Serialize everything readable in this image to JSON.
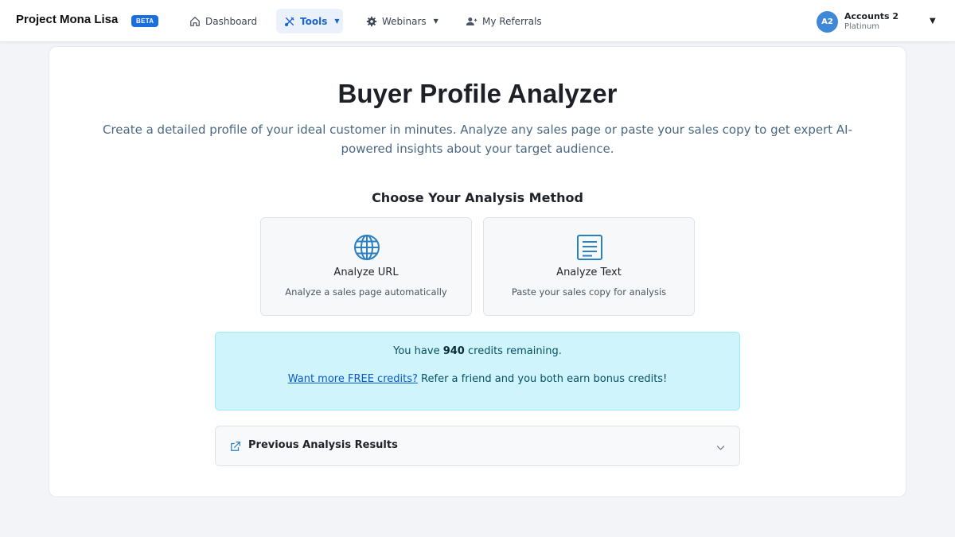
{
  "nav": {
    "brand": "Project Mona Lisa",
    "badge": "BETA",
    "items": [
      {
        "label": "Dashboard",
        "icon": "home-icon"
      },
      {
        "label": "Tools",
        "icon": "tools-icon",
        "active": true,
        "dropdown": true
      },
      {
        "label": "Webinars",
        "icon": "gear-icon",
        "dropdown": true
      },
      {
        "label": "My Referrals",
        "icon": "user-plus-icon"
      }
    ],
    "account": {
      "initials": "A2",
      "name": "Accounts 2",
      "tier": "Platinum"
    }
  },
  "main": {
    "title": "Buyer Profile Analyzer",
    "subtitle": "Create a detailed profile of your ideal customer in minutes. Analyze any sales page or paste your sales copy to get expert AI-powered insights about your target audience.",
    "method_heading": "Choose Your Analysis Method",
    "methods": [
      {
        "title": "Analyze URL",
        "description": "Analyze a sales page automatically",
        "icon": "globe-icon"
      },
      {
        "title": "Analyze Text",
        "description": "Paste your sales copy for analysis",
        "icon": "document-icon"
      }
    ],
    "credits": {
      "prefix": "You have",
      "count": "940",
      "suffix": "credits remaining.",
      "link_text": "Want more FREE credits?",
      "referral_text": "Refer a friend and you both earn bonus credits!"
    },
    "previous_results": {
      "label": "Previous Analysis Results",
      "icon": "external-link-icon"
    }
  },
  "colors": {
    "accent": "#1a6fe0",
    "nav_active_bg": "#eaf1fb",
    "credits_bg": "#cff4fc",
    "credits_border": "#9eeaf9",
    "icon_blue": "#2b7fc3",
    "subtitle": "#4b6883"
  }
}
